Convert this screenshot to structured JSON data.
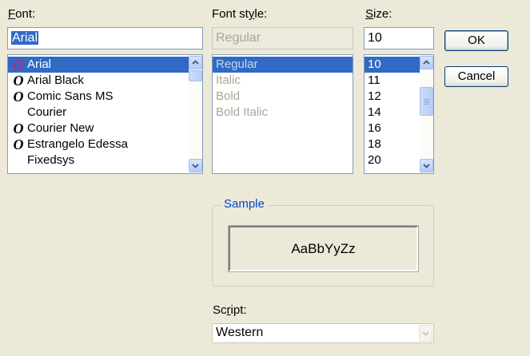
{
  "font": {
    "label": "Font:",
    "value": "Arial",
    "items": [
      {
        "name": "Arial",
        "icon": "opentype-font-icon"
      },
      {
        "name": "Arial Black",
        "icon": "opentype-font-icon"
      },
      {
        "name": "Comic Sans MS",
        "icon": "opentype-font-icon"
      },
      {
        "name": "Courier",
        "icon": "none"
      },
      {
        "name": "Courier New",
        "icon": "opentype-font-icon"
      },
      {
        "name": "Estrangelo Edessa",
        "icon": "opentype-font-icon"
      },
      {
        "name": "Fixedsys",
        "icon": "none"
      }
    ],
    "selected_index": 0
  },
  "font_style": {
    "label": "Font style:",
    "value": "Regular",
    "items": [
      "Regular",
      "Italic",
      "Bold",
      "Bold Italic"
    ],
    "selected_index": 0
  },
  "size": {
    "label": "Size:",
    "value": "10",
    "items": [
      "10",
      "11",
      "12",
      "14",
      "16",
      "18",
      "20"
    ],
    "selected_index": 0
  },
  "buttons": {
    "ok": "OK",
    "cancel": "Cancel"
  },
  "sample": {
    "title": "Sample",
    "text": "AaBbYyZz"
  },
  "script": {
    "label": "Script:",
    "value": "Western"
  },
  "colors": {
    "selection": "#316ac5",
    "dialog_bg": "#ece9d8",
    "group_title": "#0046d5",
    "font_icon_selected": "#c0286e"
  }
}
